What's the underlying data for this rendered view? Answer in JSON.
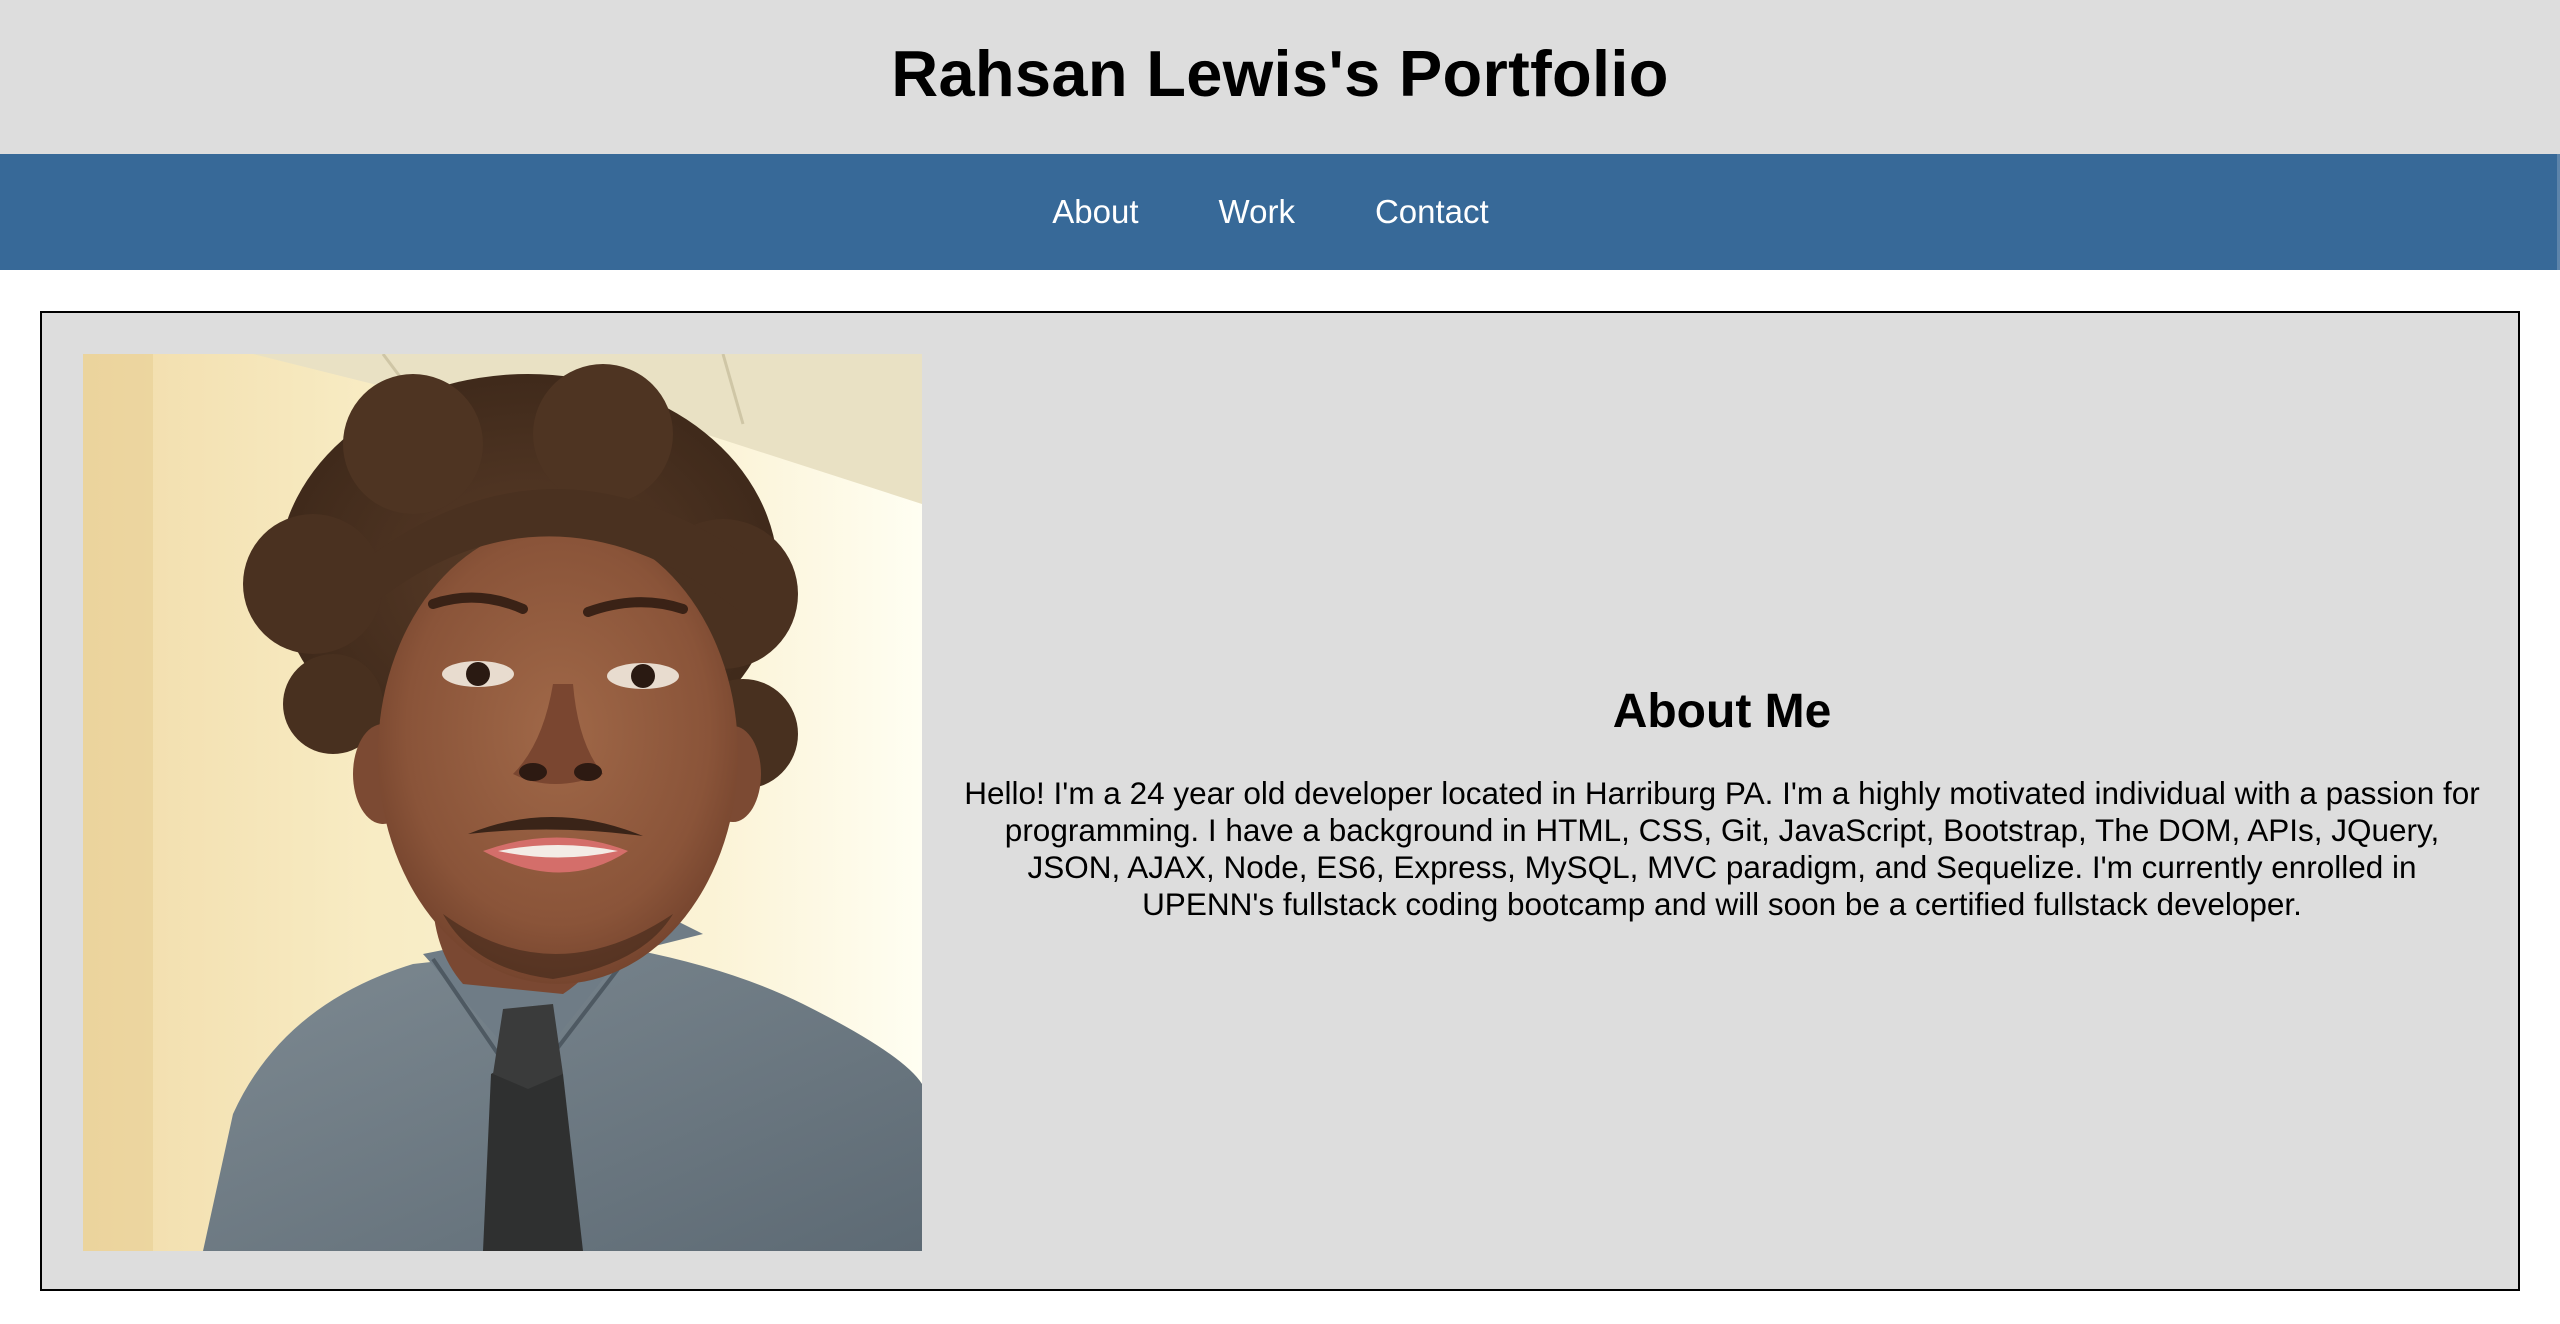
{
  "header": {
    "title": "Rahsan Lewis's Portfolio",
    "background_color": "#dddddd"
  },
  "nav": {
    "background_color": "#376998",
    "items": [
      {
        "label": "About"
      },
      {
        "label": "Work"
      },
      {
        "label": "Contact"
      }
    ]
  },
  "about": {
    "heading": "About Me",
    "body": "Hello! I'm a 24 year old developer located in Harriburg PA. I'm a highly motivated individual with a passion for programming. I have a background in HTML, CSS, Git, JavaScript, Bootstrap, The DOM, APIs, JQuery, JSON, AJAX, Node, ES6, Express, MySQL, MVC paradigm, and Sequelize. I'm currently enrolled in UPENN's fullstack coding bootcamp and will soon be a certified fullstack developer.",
    "photo_icon": "profile-photo"
  }
}
